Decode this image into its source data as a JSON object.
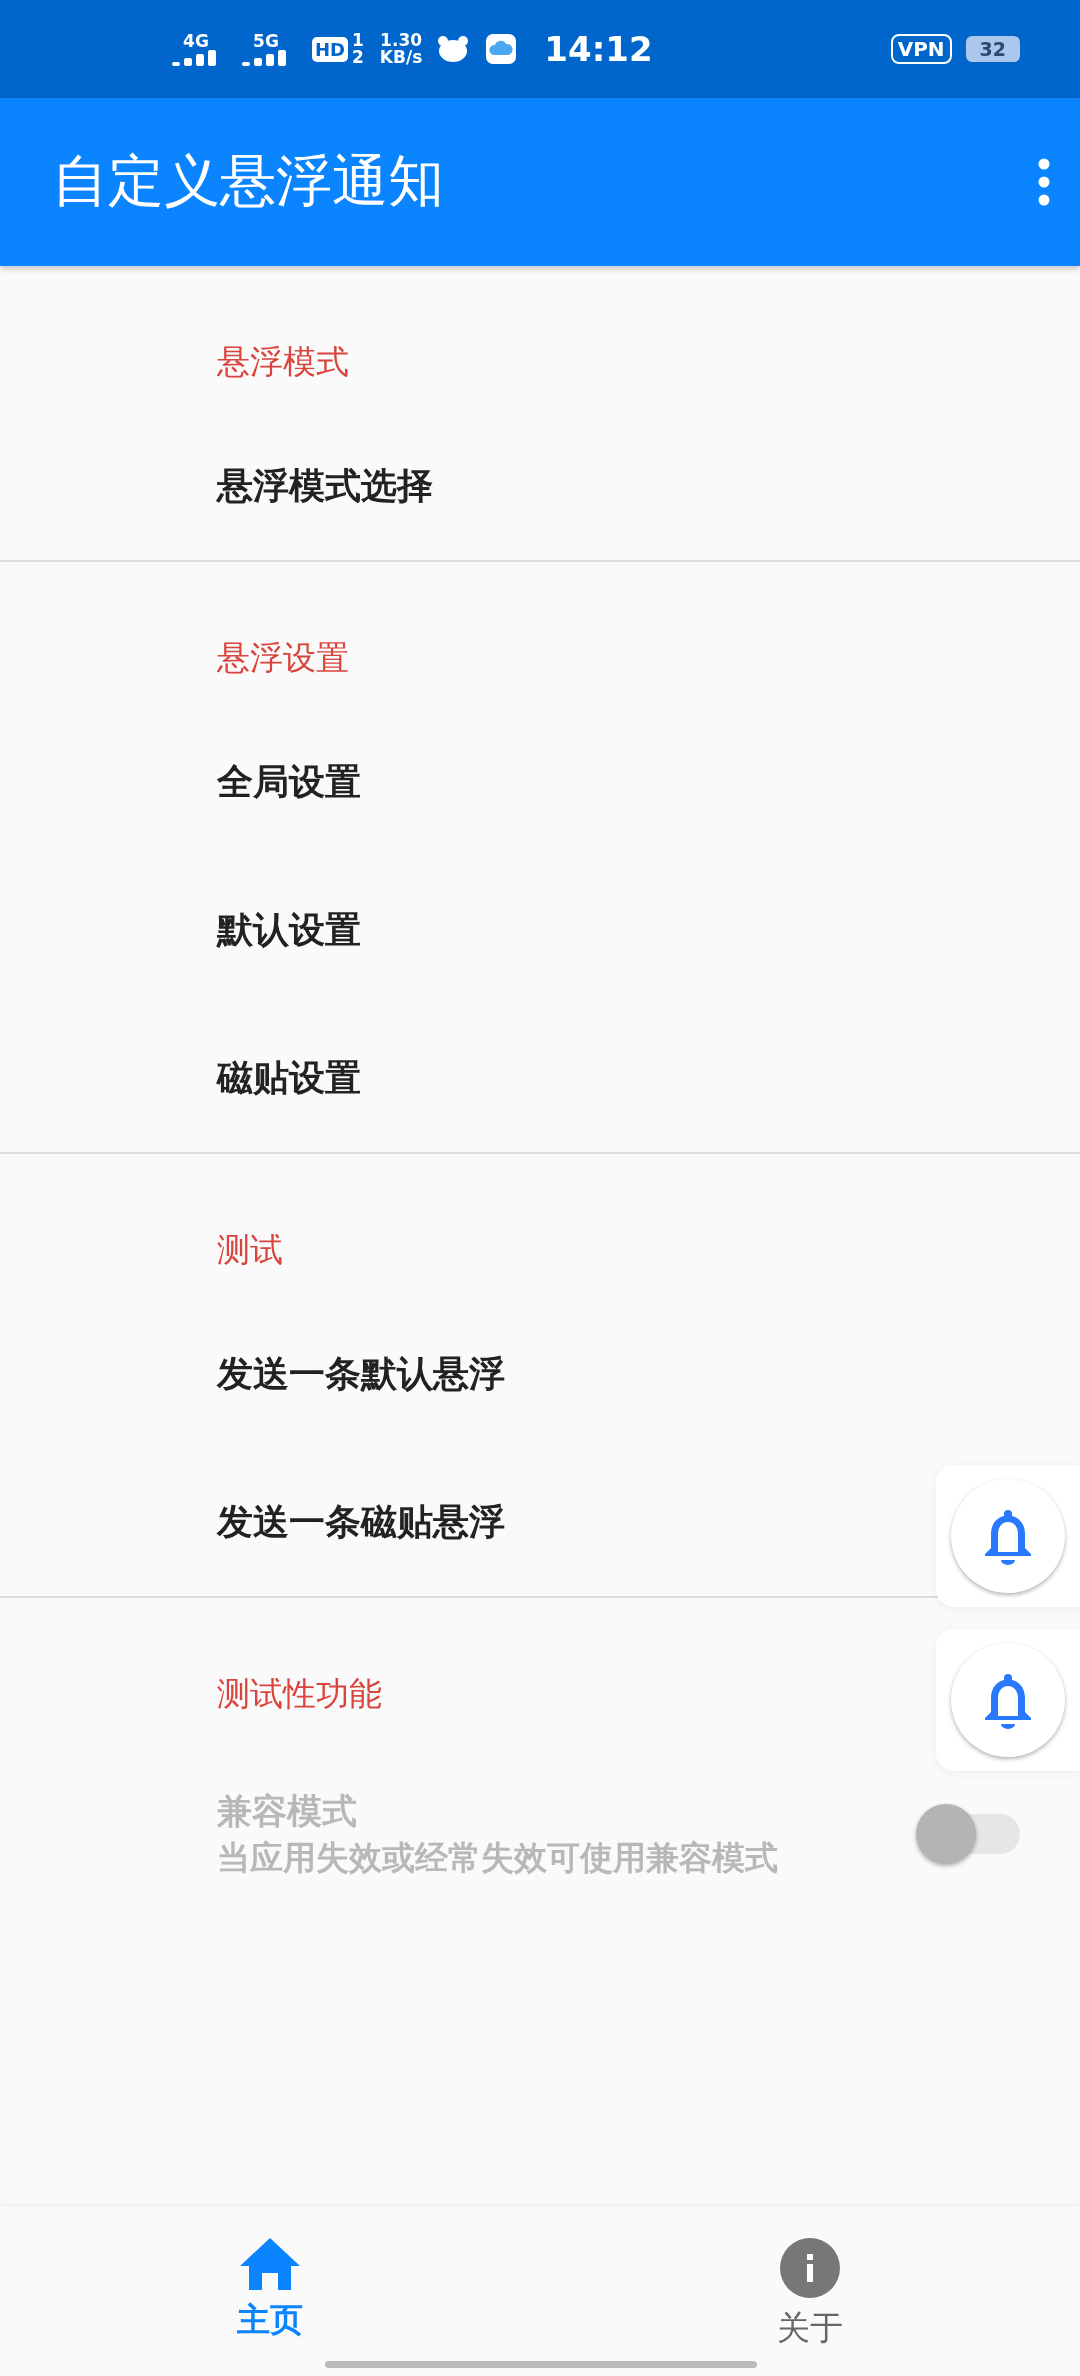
{
  "status_bar": {
    "network_1": "4G",
    "network_2": "5G",
    "hd": "HD",
    "hd_sims": [
      "1",
      "2"
    ],
    "speed": "1.30",
    "speed_unit": "KB/s",
    "time": "14:12",
    "vpn": "VPN",
    "battery": "32"
  },
  "app_bar": {
    "title": "自定义悬浮通知"
  },
  "sections": [
    {
      "header": "悬浮模式",
      "items": [
        {
          "kind": "link",
          "title": "悬浮模式选择"
        }
      ]
    },
    {
      "header": "悬浮设置",
      "items": [
        {
          "kind": "link",
          "title": "全局设置"
        },
        {
          "kind": "link",
          "title": "默认设置"
        },
        {
          "kind": "link",
          "title": "磁贴设置"
        }
      ]
    },
    {
      "header": "测试",
      "items": [
        {
          "kind": "link",
          "title": "发送一条默认悬浮"
        },
        {
          "kind": "link",
          "title": "发送一条磁贴悬浮"
        }
      ]
    },
    {
      "header": "测试性功能",
      "items": [
        {
          "kind": "switch",
          "title": "兼容模式",
          "subtitle": "当应用失效或经常失效可使用兼容模式",
          "on": false,
          "disabled": true
        }
      ]
    }
  ],
  "floating_bubbles": [
    {
      "kind": "bell"
    },
    {
      "kind": "bell"
    }
  ],
  "bottom_nav": [
    {
      "kind": "home",
      "label": "主页",
      "selected": true
    },
    {
      "kind": "info",
      "label": "关于",
      "selected": false
    }
  ]
}
